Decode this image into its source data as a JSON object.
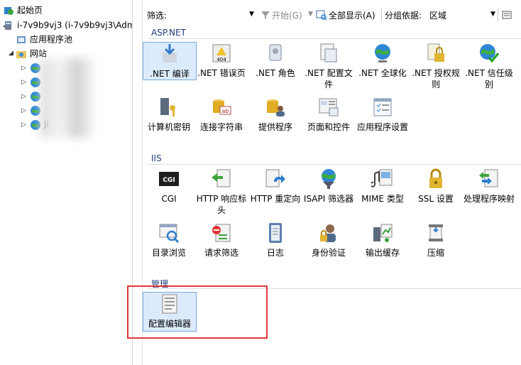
{
  "tree": {
    "items": [
      {
        "label": "起始页"
      },
      {
        "label": "i-7v9b9vj3 (i-7v9b9vj3\\Adm"
      },
      {
        "label": "应用程序池"
      },
      {
        "label": "网站"
      }
    ],
    "partial_site_label": "ji"
  },
  "toolbar": {
    "filter_label": "筛选:",
    "start_label": "开始(G)",
    "show_all_label": "全部显示(A)",
    "group_by_label": "分组依据:",
    "group_by_value": "区域"
  },
  "sections": {
    "aspnet": "ASP.NET",
    "iis": "IIS",
    "manage": "管理"
  },
  "aspnet_items": [
    {
      "label": ".NET 编译",
      "icon": "dotnet-compile-icon"
    },
    {
      "label": ".NET 错误页",
      "icon": "dotnet-error-pages-icon"
    },
    {
      "label": ".NET 角色",
      "icon": "dotnet-roles-icon"
    },
    {
      "label": ".NET 配置文件",
      "icon": "dotnet-profile-icon"
    },
    {
      "label": ".NET 全球化",
      "icon": "dotnet-globalization-icon"
    },
    {
      "label": ".NET 授权规则",
      "icon": "dotnet-authorization-icon"
    },
    {
      "label": ".NET 信任级别",
      "icon": "dotnet-trust-levels-icon"
    },
    {
      "label": "计算机密钥",
      "icon": "machine-key-icon"
    },
    {
      "label": "连接字符串",
      "icon": "connection-strings-icon"
    },
    {
      "label": "提供程序",
      "icon": "providers-icon"
    },
    {
      "label": "页面和控件",
      "icon": "pages-controls-icon"
    },
    {
      "label": "应用程序设置",
      "icon": "app-settings-icon"
    }
  ],
  "iis_items": [
    {
      "label": "CGI",
      "icon": "cgi-icon"
    },
    {
      "label": "HTTP 响应标头",
      "icon": "http-response-headers-icon"
    },
    {
      "label": "HTTP 重定向",
      "icon": "http-redirect-icon"
    },
    {
      "label": "ISAPI 筛选器",
      "icon": "isapi-filters-icon"
    },
    {
      "label": "MIME 类型",
      "icon": "mime-types-icon"
    },
    {
      "label": "SSL 设置",
      "icon": "ssl-settings-icon"
    },
    {
      "label": "处理程序映射",
      "icon": "handler-mappings-icon"
    },
    {
      "label": "目录浏览",
      "icon": "directory-browsing-icon"
    },
    {
      "label": "请求筛选",
      "icon": "request-filtering-icon"
    },
    {
      "label": "日志",
      "icon": "logging-icon"
    },
    {
      "label": "身份验证",
      "icon": "authentication-icon"
    },
    {
      "label": "输出缓存",
      "icon": "output-caching-icon"
    },
    {
      "label": "压缩",
      "icon": "compression-icon"
    }
  ],
  "manage_items": [
    {
      "label": "配置编辑器",
      "icon": "configuration-editor-icon"
    }
  ],
  "colors": {
    "section": "#1e3c78",
    "highlight": "#e0393a",
    "selected_bg": "#dcebfb"
  }
}
